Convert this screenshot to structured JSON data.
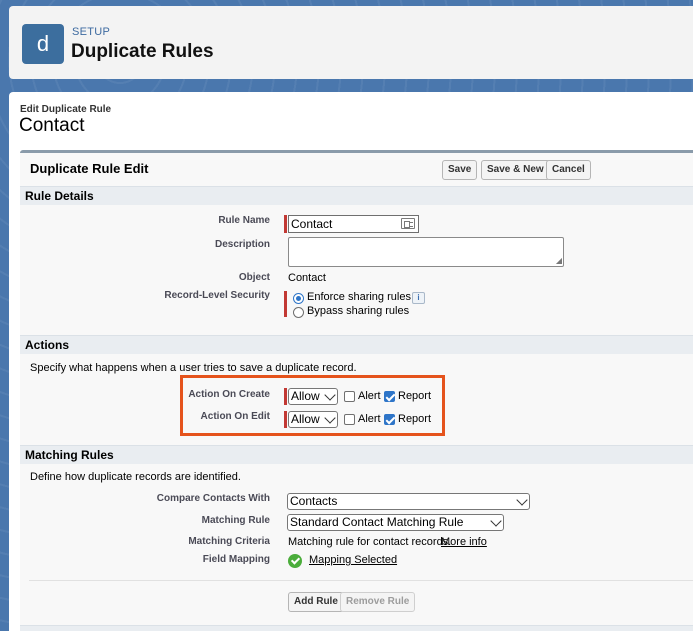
{
  "setup_header": {
    "avatar_letter": "d",
    "eyebrow": "SETUP",
    "title": "Duplicate Rules"
  },
  "page": {
    "eyebrow": "Edit Duplicate Rule",
    "title": "Contact"
  },
  "page_block": {
    "title": "Duplicate Rule Edit",
    "buttons": {
      "save": "Save",
      "save_new": "Save & New",
      "cancel": "Cancel"
    }
  },
  "rule_details": {
    "header": "Rule Details",
    "rule_name_label": "Rule Name",
    "rule_name_value": "Contact",
    "description_label": "Description",
    "description_value": "",
    "object_label": "Object",
    "object_value": "Contact",
    "security_label": "Record-Level Security",
    "security_options": [
      "Enforce sharing rules",
      "Bypass sharing rules"
    ],
    "security_selected": "Enforce sharing rules",
    "info_icon": "i"
  },
  "actions": {
    "header": "Actions",
    "description": "Specify what happens when a user tries to save a duplicate record.",
    "on_create_label": "Action On Create",
    "on_create_value": "Allow",
    "on_edit_label": "Action On Edit",
    "on_edit_value": "Allow",
    "alert_label": "Alert",
    "report_label": "Report",
    "create_alert_checked": false,
    "create_report_checked": true,
    "edit_alert_checked": false,
    "edit_report_checked": true,
    "highlight_color": "#e5531c"
  },
  "matching_rules": {
    "header": "Matching Rules",
    "description": "Define how duplicate records are identified.",
    "compare_label": "Compare Contacts With",
    "compare_value": "Contacts",
    "matching_rule_label": "Matching Rule",
    "matching_rule_value": "Standard Contact Matching Rule",
    "criteria_label": "Matching Criteria",
    "criteria_text": "Matching rule for contact records.",
    "criteria_link": "More info",
    "field_mapping_label": "Field Mapping",
    "field_mapping_link": "Mapping Selected",
    "add_rule_button": "Add Rule",
    "remove_rule_button": "Remove Rule"
  },
  "colors": {
    "required_bar": "#c23934",
    "accent_blue": "#2e75c8",
    "success_green": "#4bad3b"
  }
}
